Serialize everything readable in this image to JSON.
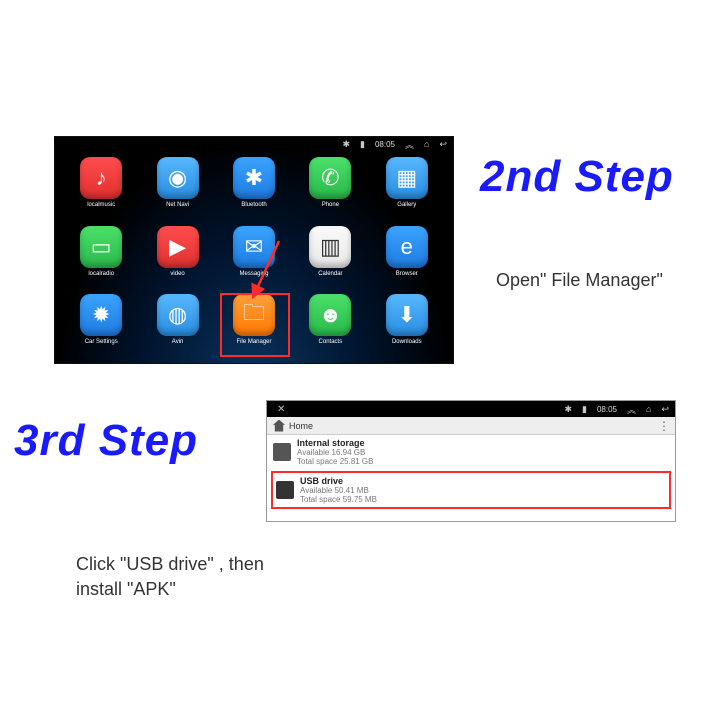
{
  "step2": {
    "heading": "2nd Step",
    "caption": "Open\"  File  Manager\"",
    "statusbar": {
      "time": "08:05"
    }
  },
  "apps": [
    {
      "name": "localmusic",
      "icon": "♪",
      "cls": "red"
    },
    {
      "name": "Net Navi",
      "icon": "◉",
      "cls": "ltblue"
    },
    {
      "name": "Bluetooth",
      "icon": "✱",
      "cls": "blue"
    },
    {
      "name": "Phone",
      "icon": "✆",
      "cls": "green"
    },
    {
      "name": "Gallery",
      "icon": "▦",
      "cls": "ltblue"
    },
    {
      "name": "localradio",
      "icon": "▭",
      "cls": "green"
    },
    {
      "name": "video",
      "icon": "▶",
      "cls": "red"
    },
    {
      "name": "Messaging",
      "icon": "✉",
      "cls": "blue"
    },
    {
      "name": "Calendar",
      "icon": "▥",
      "cls": "white"
    },
    {
      "name": "Browser",
      "icon": "e",
      "cls": "blue"
    },
    {
      "name": "Car Settings",
      "icon": "✹",
      "cls": "blue"
    },
    {
      "name": "Avin",
      "icon": "◍",
      "cls": "ltblue"
    },
    {
      "name": "File Manager",
      "icon": "🗀",
      "cls": "orange"
    },
    {
      "name": "Contacts",
      "icon": "☻",
      "cls": "green"
    },
    {
      "name": "Downloads",
      "icon": "⬇",
      "cls": "ltblue"
    }
  ],
  "step3": {
    "heading": "3rd Step",
    "caption": "Click  \"USB drive\"  , then install  \"APK\"",
    "statusbar": {
      "time": "08:05"
    },
    "breadcrumb": "Home",
    "rows": [
      {
        "title": "Internal storage",
        "line1": "Available 16.94 GB",
        "line2": "Total space 25.81 GB"
      },
      {
        "title": "USB drive",
        "line1": "Available 50.41 MB",
        "line2": "Total space 59.75 MB"
      }
    ]
  }
}
